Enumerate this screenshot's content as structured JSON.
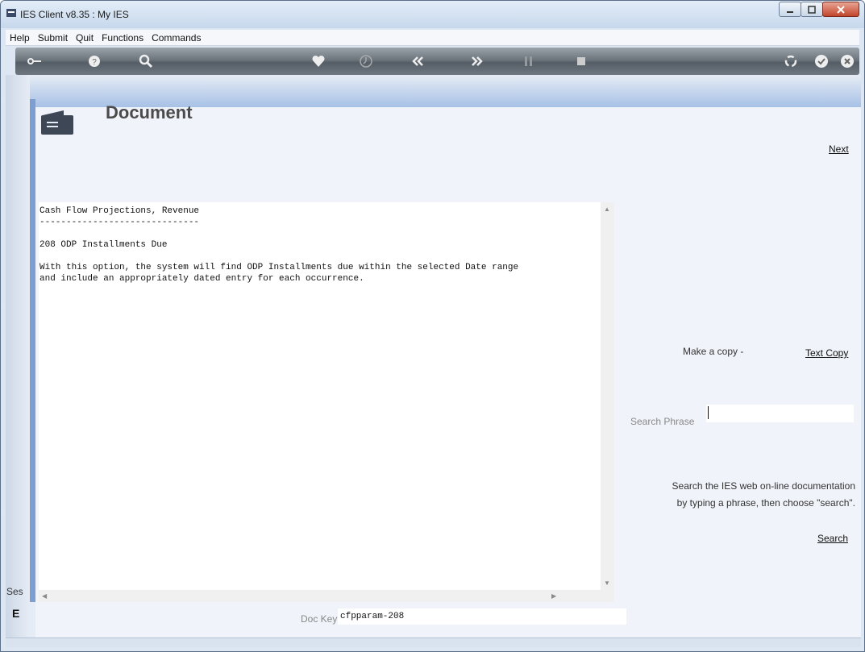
{
  "window": {
    "title": "IES Client v8.35 : My IES",
    "controls": [
      "minimize-icon",
      "maximize-icon",
      "close-icon"
    ]
  },
  "menu": {
    "items": [
      {
        "label": "Help"
      },
      {
        "label": "Submit"
      },
      {
        "label": "Quit"
      },
      {
        "label": "Functions"
      },
      {
        "label": "Commands"
      }
    ]
  },
  "toolbar": {
    "icons": [
      "key-icon",
      "help-icon",
      "search-icon",
      "heart-icon",
      "clock-icon",
      "rewind-icon",
      "fast-forward-icon",
      "tools-icon",
      "stop-icon",
      "recycle-icon",
      "check-icon",
      "close-icon"
    ]
  },
  "page": {
    "title": "Document",
    "next_label": "Next"
  },
  "document": {
    "lines": [
      "Cash Flow Projections, Revenue",
      "------------------------------",
      "",
      "208 ODP Installments Due",
      "",
      "With this option, the system will find ODP Installments due within the selected Date range",
      "and include an appropriately dated entry for each occurrence."
    ]
  },
  "copy": {
    "label": "Make a copy -",
    "link": "Text Copy"
  },
  "search": {
    "label": "Search Phrase",
    "value": "",
    "help_line1": "Search the IES web on-line documentation",
    "help_line2": "by typing a phrase, then choose \"search\".",
    "link": "Search"
  },
  "doc_key": {
    "label": "Doc Key",
    "value": "cfpparam-208"
  },
  "sidebar": {
    "session_label": "Ses",
    "glyph": "E"
  },
  "colors": {
    "accent": "#7c9ed0",
    "toolbar": "#6c747c",
    "close_button": "#c3452c"
  }
}
